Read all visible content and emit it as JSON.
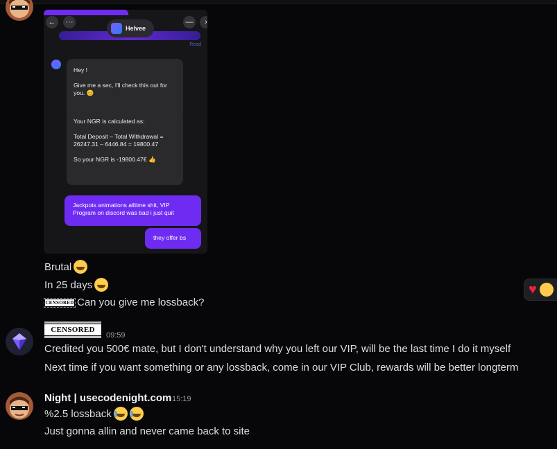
{
  "screenshot": {
    "controls": {
      "back": "←",
      "more": "···",
      "minimize": "—",
      "close": "›"
    },
    "header_name": "Helvee",
    "read_label": "Read",
    "bot_messages": [
      "Hey !\n\nGive me a sec, I'll check this out for you. 😊",
      "Your NGR is calculated as:\n\nTotal Deposit – Total Withdrawal = 26247.31 – 6446.84 = 19800.47\n\nSo your NGR is -19800.47€ 👍"
    ],
    "user_messages": [
      "Jackpots animations alltime shit, VIP Program on discord was bad i just quit",
      "they offer bs"
    ]
  },
  "messages_top": [
    {
      "text": "Brutal",
      "emoji": "grinning-squint-emoji"
    },
    {
      "text": "In 25 days",
      "emoji": "grinning-squint-emoji"
    },
    {
      "text": "Can you give me lossback?",
      "censor_label": "CENSORED"
    }
  ],
  "reply_group": {
    "author_censor": "CENSORED",
    "time": "09:59",
    "lines": [
      "Credited you 500€ mate, but I don't understand why you left our VIP, will be the last time I do it myself",
      "Next time if you want something or any lossback, come in our VIP Club, rewards will be better longterm"
    ]
  },
  "night_group": {
    "author": "Night | usecodenight.com",
    "time": "15:19",
    "lines": [
      "%2.5 lossback",
      "Just gonna allin and never came back to site"
    ]
  },
  "reactions": [
    {
      "icon": "heart-icon",
      "glyph": "♥"
    },
    {
      "icon": "emoji-icon"
    }
  ],
  "colors": {
    "accent": "#6e2cf3",
    "background": "#070709",
    "text": "#dbdee1",
    "timestamp": "#949ba4"
  }
}
